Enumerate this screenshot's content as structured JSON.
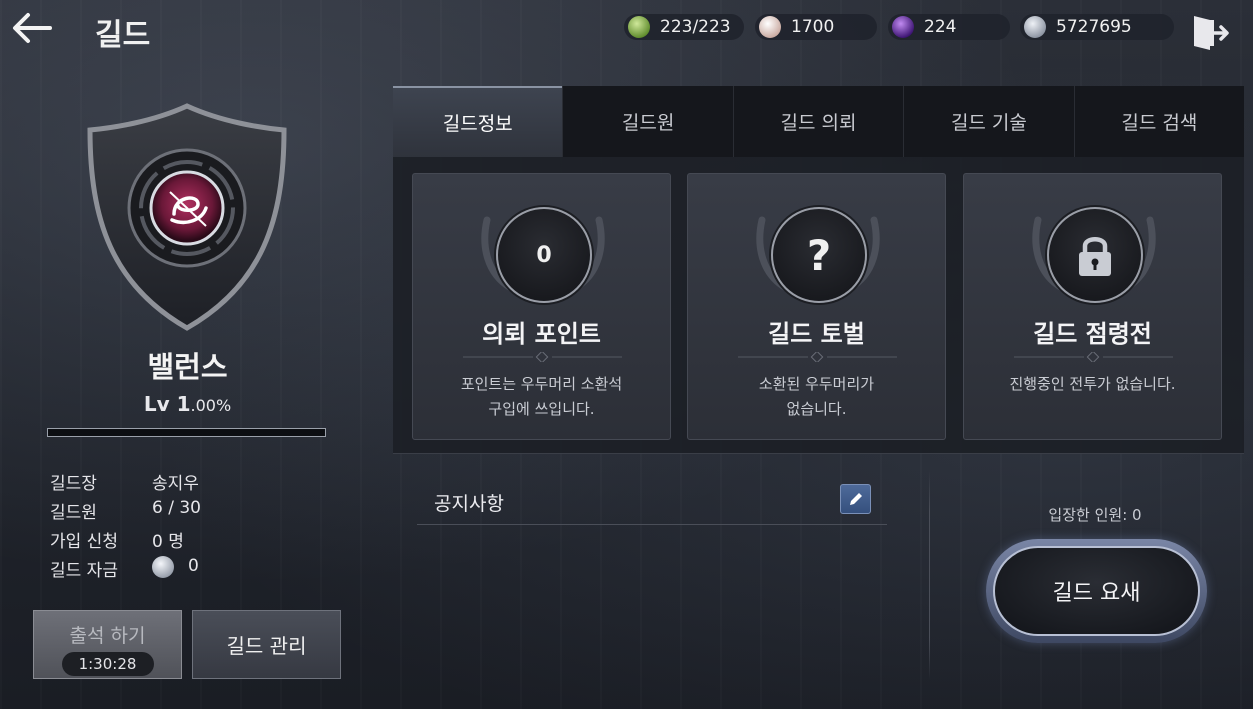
{
  "header": {
    "title": "길드",
    "currencies": [
      {
        "name": "stamina-icon",
        "value": "223/223",
        "color": "#7fae3a"
      },
      {
        "name": "pearl-icon",
        "value": "1700",
        "color": "#e8d8d0"
      },
      {
        "name": "purple-gem-icon",
        "value": "224",
        "color": "#7a3ac8"
      },
      {
        "name": "silver-coin-icon",
        "value": "5727695",
        "color": "#b9c0cc"
      }
    ]
  },
  "guild": {
    "name": "밸런스",
    "level": "Lv 1",
    "level_pct": ".00%",
    "exp_fraction": 0.0,
    "info": [
      {
        "key": "길드장",
        "value": "송지우"
      },
      {
        "key": "길드원",
        "value": "6 / 30"
      },
      {
        "key": "가입 신청",
        "value": "0 명"
      },
      {
        "key": "길드 자금",
        "value": "0"
      }
    ],
    "attend_label": "출석 하기",
    "attend_timer": "1:30:28",
    "manage_label": "길드 관리"
  },
  "tabs": [
    "길드정보",
    "길드원",
    "길드 의뢰",
    "길드 기술",
    "길드 검색"
  ],
  "cards": [
    {
      "badge": "0",
      "title": "의뢰 포인트",
      "desc": "포인트는 우두머리 소환석\n구입에 쓰입니다."
    },
    {
      "badge": "?",
      "title": "길드 토벌",
      "desc": "소환된 우두머리가\n없습니다."
    },
    {
      "badge": "lock-icon",
      "title": "길드 점령전",
      "desc": "진행중인 전투가 없습니다."
    }
  ],
  "notice": {
    "title": "공지사항"
  },
  "fortress": {
    "entered": "입장한 인원: 0",
    "button": "길드 요새"
  },
  "colors": {
    "accent": "#8a93a3",
    "panel": "#15171c"
  }
}
